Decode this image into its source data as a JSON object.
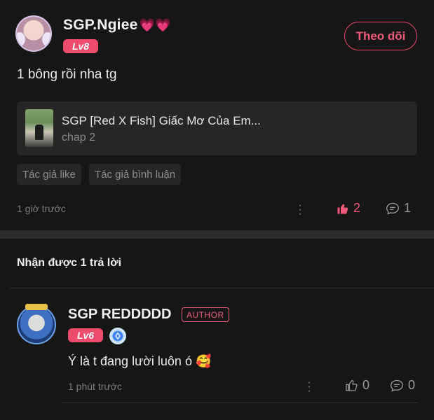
{
  "post": {
    "username": "SGP.Ngiee",
    "username_emoji": "💗💗",
    "level": "Lv8",
    "follow_label": "Theo dõi",
    "content": "1 bông rồi nha tg",
    "card": {
      "title": "SGP [Red X Fish] Giấc Mơ Của Em...",
      "subtitle": "chap 2"
    },
    "tags": [
      "Tác giả like",
      "Tác giả bình luận"
    ],
    "time": "1 giờ trước",
    "likes": "2",
    "comments": "1",
    "like_color": "#ef5a79"
  },
  "replies_header": "Nhận được 1 trả lời",
  "reply": {
    "username": "SGP REDDDDD",
    "author_badge": "AUTHOR",
    "level": "Lv6",
    "content": "Ý là t đang lười luôn ó",
    "emoji": "🥰",
    "time": "1 phút trước",
    "likes": "0",
    "comments": "0"
  },
  "colors": {
    "accent": "#ee4b6d",
    "background": "#161616",
    "card": "#262626"
  }
}
